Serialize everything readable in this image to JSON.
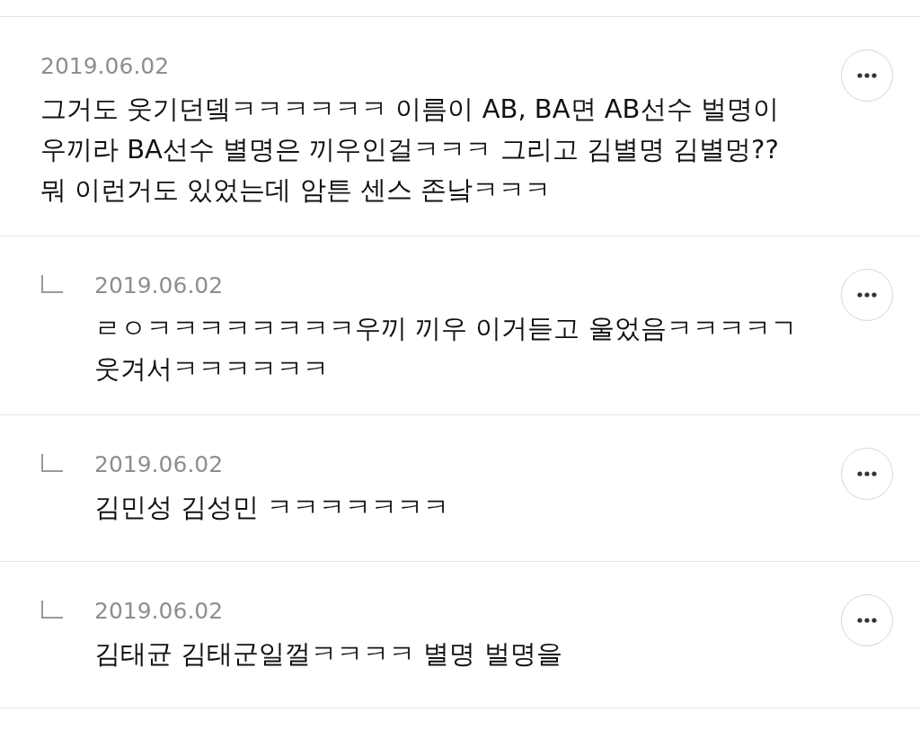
{
  "comments": [
    {
      "kind": "comment",
      "date": "2019.06.02",
      "lines": [
        "그거도 웃기던뎈ㅋㅋㅋㅋㅋㅋ 이름이 AB, BA면 AB선수 벌명이",
        "우끼라 BA선수 별명은 끼우인걸ㅋㅋㅋ 그리고 김별명 김별멍??",
        "뭐 이런거도 있었는데 암튼 센스 존낰ㅋㅋㅋ"
      ]
    },
    {
      "kind": "reply",
      "date": "2019.06.02",
      "lines": [
        "ㄹㅇㅋㅋㅋㅋㅋㅋㅋㅋ우끼 끼우 이거듣고 울었음ㅋㅋㅋㅋㄱ",
        "웃겨서ㅋㅋㅋㅋㅋㅋ"
      ]
    },
    {
      "kind": "reply",
      "date": "2019.06.02",
      "lines": [
        "김민성 김성민 ㅋㅋㅋㅋㅋㅋㅋ"
      ]
    },
    {
      "kind": "reply",
      "date": "2019.06.02",
      "lines": [
        "김태균 김태군일껄ㅋㅋㅋㅋ 별명 벌명을"
      ]
    }
  ]
}
